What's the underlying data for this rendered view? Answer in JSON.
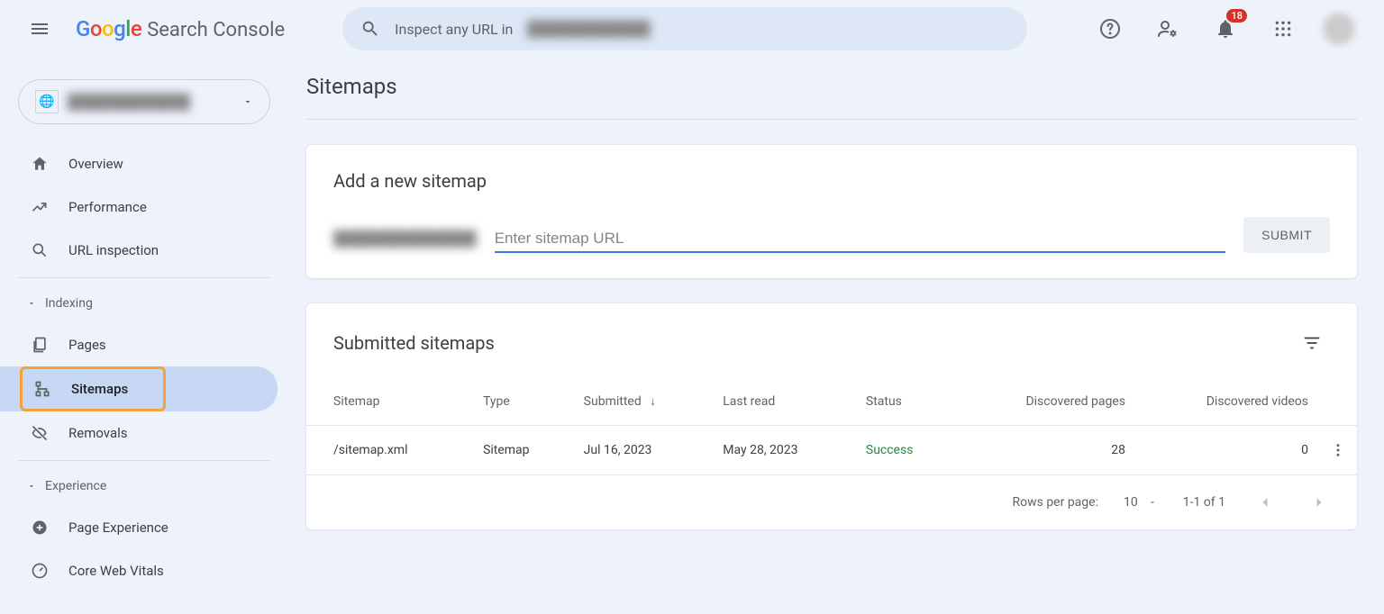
{
  "header": {
    "product": "Search Console",
    "search_prefix": "Inspect any URL in",
    "search_obscured": "████████████",
    "notif_count": "18"
  },
  "sidebar": {
    "property_name": "████████████",
    "items": {
      "overview": "Overview",
      "performance": "Performance",
      "url_inspection": "URL inspection",
      "pages": "Pages",
      "sitemaps": "Sitemaps",
      "removals": "Removals",
      "page_experience": "Page Experience",
      "core_web_vitals": "Core Web Vitals"
    },
    "sections": {
      "indexing": "Indexing",
      "experience": "Experience"
    }
  },
  "page": {
    "title": "Sitemaps",
    "add_card": {
      "title": "Add a new sitemap",
      "url_prefix": "██████████████",
      "placeholder": "Enter sitemap URL",
      "submit": "SUBMIT"
    },
    "submitted_card": {
      "title": "Submitted sitemaps",
      "columns": {
        "sitemap": "Sitemap",
        "type": "Type",
        "submitted": "Submitted",
        "last_read": "Last read",
        "status": "Status",
        "discovered_pages": "Discovered pages",
        "discovered_videos": "Discovered videos"
      },
      "rows": [
        {
          "sitemap": "/sitemap.xml",
          "type": "Sitemap",
          "submitted": "Jul 16, 2023",
          "last_read": "May 28, 2023",
          "status": "Success",
          "discovered_pages": "28",
          "discovered_videos": "0"
        }
      ],
      "pager": {
        "rpp_label": "Rows per page:",
        "rpp_value": "10",
        "range": "1-1 of 1"
      }
    }
  }
}
